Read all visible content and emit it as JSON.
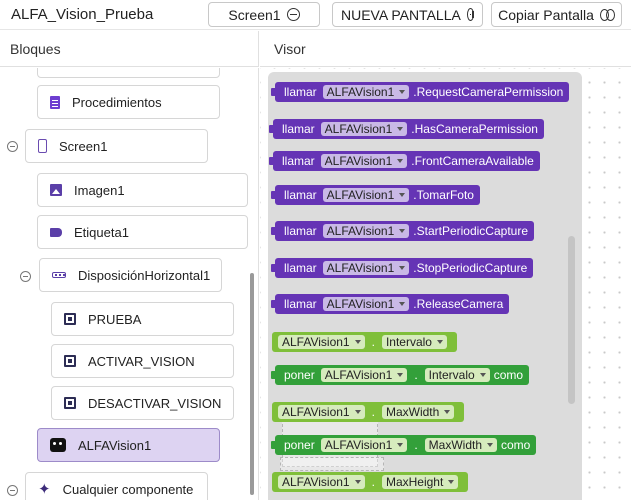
{
  "app": {
    "title": "ALFA_Vision_Prueba",
    "screen_select": "Screen1",
    "new_screen": "NUEVA PANTALLA",
    "copy_screen": "Copiar Pantalla"
  },
  "left": {
    "header": "Bloques",
    "items": [
      {
        "label": "Procedimientos",
        "icon": "procedures-icon"
      },
      {
        "label": "Screen1",
        "icon": "phone-icon"
      },
      {
        "label": "Imagen1",
        "icon": "image-icon"
      },
      {
        "label": "Etiqueta1",
        "icon": "label-icon"
      },
      {
        "label": "DisposiciónHorizontal1",
        "icon": "horizontal-arrangement-icon"
      },
      {
        "label": "PRUEBA",
        "icon": "button-icon"
      },
      {
        "label": "ACTIVAR_VISION",
        "icon": "button-icon"
      },
      {
        "label": "DESACTIVAR_VISION",
        "icon": "button-icon"
      },
      {
        "label": "ALFAVision1",
        "icon": "robot-icon"
      },
      {
        "label": "Cualquier componente",
        "icon": "sparkle-icon"
      }
    ]
  },
  "right": {
    "header": "Visor",
    "blocks": [
      {
        "kw": "llamar",
        "comp": "ALFAVision1",
        "member": ".RequestCameraPermission"
      },
      {
        "kw": "llamar",
        "comp": "ALFAVision1",
        "member": ".HasCameraPermission"
      },
      {
        "kw": "llamar",
        "comp": "ALFAVision1",
        "member": ".FrontCameraAvailable"
      },
      {
        "kw": "llamar",
        "comp": "ALFAVision1",
        "member": ".TomarFoto"
      },
      {
        "kw": "llamar",
        "comp": "ALFAVision1",
        "member": ".StartPeriodicCapture"
      },
      {
        "kw": "llamar",
        "comp": "ALFAVision1",
        "member": ".StopPeriodicCapture"
      },
      {
        "kw": "llamar",
        "comp": "ALFAVision1",
        "member": ".ReleaseCamera"
      },
      {
        "comp": "ALFAVision1",
        "dot": ".",
        "prop": "Intervalo"
      },
      {
        "kw": "poner",
        "comp": "ALFAVision1",
        "dot": ".",
        "prop": "Intervalo",
        "tail": "como"
      },
      {
        "comp": "ALFAVision1",
        "dot": ".",
        "prop": "MaxWidth"
      },
      {
        "kw": "poner",
        "comp": "ALFAVision1",
        "dot": ".",
        "prop": "MaxWidth",
        "tail": "como"
      },
      {
        "comp": "ALFAVision1",
        "dot": ".",
        "prop": "MaxHeight"
      }
    ]
  },
  "colors": {
    "method_block": "#6534b5",
    "getter_block": "#7fbf3a",
    "setter_block": "#33a03a",
    "selected_item": "#ddd3f2"
  }
}
